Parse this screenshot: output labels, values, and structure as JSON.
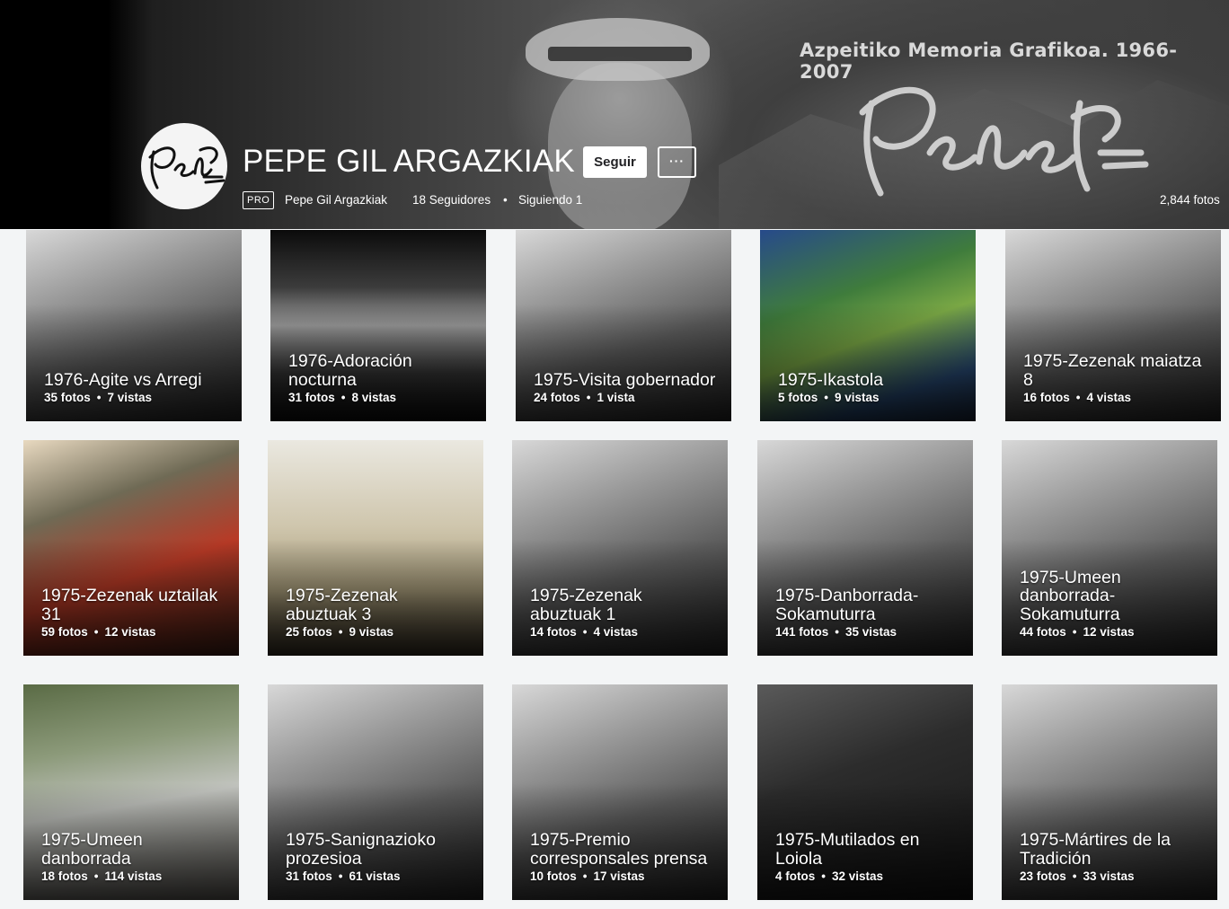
{
  "header": {
    "tagline": "Azpeitiko Memoria Grafikoa. 1966-2007",
    "title": "PEPE GIL ARGAZKIAK",
    "follow_button": "Seguir",
    "more_button": "···",
    "pro_badge": "PRO",
    "owner_name": "Pepe Gil Argazkiak",
    "followers": "18 Seguidores",
    "separator": "•",
    "following": "Siguiendo 1",
    "photo_count": "2,844 fotos"
  },
  "albums": [
    {
      "name": "1976-Agite vs Arregi",
      "photos": "35 fotos",
      "views": "7 vistas",
      "sep": "•",
      "tone": "bw"
    },
    {
      "name": "1976-Adoración nocturna",
      "photos": "31 fotos",
      "views": "8 vistas",
      "sep": "•",
      "tone": "night"
    },
    {
      "name": "1975-Visita gobernador",
      "photos": "24 fotos",
      "views": "1 vista",
      "sep": "•",
      "tone": "bw"
    },
    {
      "name": "1975-Ikastola",
      "photos": "5 fotos",
      "views": "9 vistas",
      "sep": "•",
      "tone": "color"
    },
    {
      "name": "1975-Zezenak maiatza 8",
      "photos": "16 fotos",
      "views": "4 vistas",
      "sep": "•",
      "tone": "bw"
    },
    {
      "name": "1975-Zezenak uztailak 31",
      "photos": "59 fotos",
      "views": "12 vistas",
      "sep": "•",
      "tone": "warm"
    },
    {
      "name": "1975-Zezenak abuztuak 3",
      "photos": "25 fotos",
      "views": "9 vistas",
      "sep": "•",
      "tone": "sand"
    },
    {
      "name": "1975-Zezenak abuztuak 1",
      "photos": "14 fotos",
      "views": "4 vistas",
      "sep": "•",
      "tone": "bw"
    },
    {
      "name": "1975-Danborrada-Sokamuturra",
      "photos": "141 fotos",
      "views": "35 vistas",
      "sep": "•",
      "tone": "bw"
    },
    {
      "name": "1975-Umeen danborrada-Sokamuturra",
      "photos": "44 fotos",
      "views": "12 vistas",
      "sep": "•",
      "tone": "bw"
    },
    {
      "name": "1975-Umeen danborrada",
      "photos": "18 fotos",
      "views": "114 vistas",
      "sep": "•",
      "tone": "green"
    },
    {
      "name": "1975-Sanignazioko prozesioa",
      "photos": "31 fotos",
      "views": "61 vistas",
      "sep": "•",
      "tone": "bw"
    },
    {
      "name": "1975-Premio corresponsales prensa",
      "photos": "10 fotos",
      "views": "17 vistas",
      "sep": "•",
      "tone": "bw"
    },
    {
      "name": "1975-Mutilados en Loiola",
      "photos": "4 fotos",
      "views": "32 vistas",
      "sep": "•",
      "tone": "dark"
    },
    {
      "name": "1975-Mártires de la Tradición",
      "photos": "23 fotos",
      "views": "33 vistas",
      "sep": "•",
      "tone": "bw"
    }
  ]
}
